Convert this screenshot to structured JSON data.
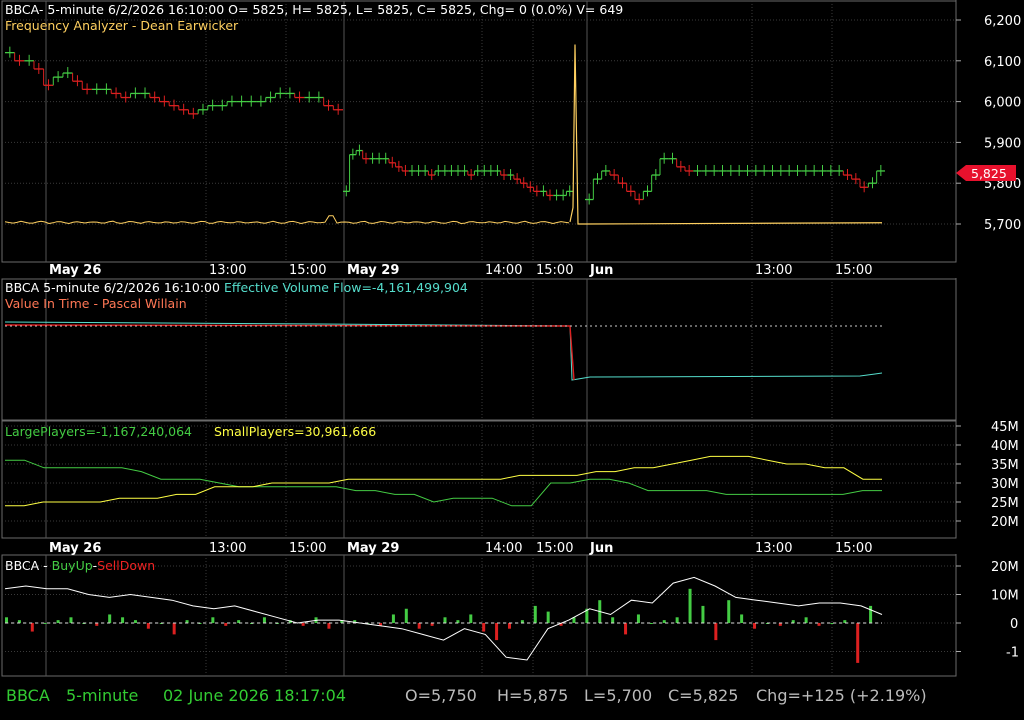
{
  "colors": {
    "background": "#000000",
    "grid": "#3a3a3a",
    "panel_border": "#6a6a6a",
    "bar_up": "#44cc44",
    "bar_down": "#dd2020",
    "frequency": "#ffd060",
    "white_line": "#ffffff",
    "evf": "#55ddcc",
    "large_players": "#44cc44",
    "small_players": "#ffff44",
    "status_green": "#33cc33",
    "status_gray": "#bbbbbb",
    "price_tag": "#e8112d"
  },
  "panel1": {
    "title": "BBCA- 5-minute 6/2/2026 16:10:00 O= 5825, H= 5825, L= 5825, C= 5825, Chg= 0 (0.0%) V= 649",
    "subtitle": "Frequency Analyzer - Dean Earwicker",
    "y_ticks": [
      "6,200",
      "6,100",
      "6,000",
      "5,900",
      "5,800",
      "5,700"
    ],
    "last_price": "5,825"
  },
  "time_axis": {
    "labels": [
      {
        "text": "May 26",
        "bold": true
      },
      {
        "text": "13:00",
        "bold": false
      },
      {
        "text": "15:00",
        "bold": false
      },
      {
        "text": "May 29",
        "bold": true
      },
      {
        "text": "14:00",
        "bold": false
      },
      {
        "text": "15:00",
        "bold": false
      },
      {
        "text": "Jun",
        "bold": true
      },
      {
        "text": "13:00",
        "bold": false
      },
      {
        "text": "15:00",
        "bold": false
      }
    ]
  },
  "panel2": {
    "title_prefix": "BBCA 5-minute  6/2/2026 16:10:00  ",
    "title_value": "Effective Volume Flow=-4,161,499,904",
    "subtitle": "Value In Time - Pascal Willain"
  },
  "panel3": {
    "large_label": "LargePlayers=-1,167,240,064",
    "small_label": "SmallPlayers=30,961,666",
    "y_ticks": [
      "45M",
      "40M",
      "35M",
      "30M",
      "25M",
      "20M"
    ]
  },
  "panel4": {
    "title_prefix": "BBCA - ",
    "title_up": "BuyUp",
    "title_sep": "-",
    "title_down": "SellDown",
    "y_ticks": [
      "20M",
      "10M",
      "0",
      "-1"
    ]
  },
  "status_bar": {
    "symbol": "BBCA",
    "interval": "5-minute",
    "datetime": "02 June 2026 18:17:04",
    "open": "O=5,750",
    "high": "H=5,875",
    "low": "L=5,700",
    "close": "C=5,825",
    "change": "Chg=+125 (+2.19%)"
  },
  "chart_data": {
    "type": "line",
    "price_panel": {
      "y_unit": "IDR",
      "ylim": [
        5670,
        6230
      ],
      "segments": [
        {
          "session": "May 26",
          "values": [
            6120,
            6100,
            6100,
            6080,
            6040,
            6060,
            6070,
            6050,
            6030,
            6030,
            6030,
            6020,
            6010,
            6020,
            6020,
            6010,
            6000,
            5990,
            5980,
            5970,
            5980,
            5990,
            5990,
            6000,
            6000,
            6000,
            6000,
            6010,
            6020,
            6020,
            6010,
            6010,
            6010,
            5990,
            5980
          ]
        },
        {
          "session": "May 29",
          "values": [
            5780,
            5870,
            5880,
            5860,
            5860,
            5860,
            5860,
            5850,
            5840,
            5830,
            5830,
            5830,
            5830,
            5820,
            5830,
            5830,
            5830,
            5830,
            5830,
            5820,
            5830,
            5830,
            5830,
            5830,
            5820,
            5820,
            5810,
            5800,
            5790,
            5780,
            5780,
            5770,
            5770,
            5770,
            5780
          ]
        },
        {
          "session": "Jun 2",
          "values": [
            5760,
            5810,
            5830,
            5820,
            5800,
            5780,
            5760,
            5780,
            5820,
            5860,
            5860,
            5840,
            5830,
            5830,
            5830,
            5830,
            5830,
            5830,
            5830,
            5830,
            5830,
            5830,
            5830,
            5830,
            5830,
            5830,
            5830,
            5830,
            5830,
            5830,
            5830,
            5820,
            5810,
            5790,
            5800,
            5830
          ]
        }
      ],
      "frequency_analyzer_note": "flat near 5,700 with one spike to ~6,140 at session change May 29 to Jun"
    },
    "evf_panel": {
      "series": [
        {
          "name": "Effective Volume Flow",
          "last": -4161499904
        }
      ]
    },
    "players_panel": {
      "y_unit": "M",
      "ylim": [
        17,
        47
      ],
      "series": [
        {
          "name": "LargePlayers",
          "values": [
            36,
            36,
            34,
            34,
            34,
            34,
            34,
            33,
            31,
            31,
            31,
            30,
            29,
            29,
            29,
            29,
            29,
            29,
            28,
            28,
            27,
            27,
            25,
            26,
            26,
            26,
            24,
            24,
            30,
            30,
            31,
            31,
            30,
            28,
            28,
            28,
            28,
            27,
            27,
            27,
            27,
            27,
            27,
            27,
            28,
            28
          ]
        },
        {
          "name": "SmallPlayers",
          "values": [
            24,
            24,
            25,
            25,
            25,
            25,
            26,
            26,
            26,
            27,
            27,
            29,
            29,
            29,
            30,
            30,
            30,
            30,
            31,
            31,
            31,
            31,
            31,
            31,
            31,
            31,
            31,
            32,
            32,
            32,
            32,
            33,
            33,
            34,
            34,
            35,
            36,
            37,
            37,
            37,
            36,
            35,
            35,
            34,
            34,
            31,
            31
          ]
        }
      ]
    },
    "buyup_selldown_panel": {
      "y_unit": "M",
      "ylim": [
        -18,
        25
      ],
      "bars": [
        2,
        1,
        -3,
        0,
        1,
        2,
        0,
        -1,
        3,
        2,
        1,
        -2,
        0,
        -4,
        1,
        0,
        2,
        -1,
        1,
        0,
        2,
        0,
        1,
        -1,
        2,
        -2,
        1,
        1,
        0,
        -1,
        3,
        5,
        -2,
        -1,
        2,
        1,
        3,
        -3,
        -6,
        -2,
        1,
        6,
        4,
        -1,
        2,
        5,
        8,
        2,
        -4,
        3,
        0,
        1,
        2,
        12,
        6,
        -6,
        8,
        3,
        -2,
        0,
        -1,
        1,
        2,
        -1,
        0,
        1,
        -14,
        6
      ],
      "white_line": [
        12,
        13,
        12,
        12,
        10,
        9,
        10,
        9,
        8,
        6,
        5,
        6,
        4,
        2,
        0,
        1,
        1,
        0,
        -1,
        -2,
        -4,
        -6,
        -2,
        -4,
        -12,
        -13,
        -2,
        1,
        5,
        3,
        8,
        7,
        14,
        16,
        13,
        9,
        8,
        7,
        6,
        7,
        7,
        6,
        3
      ]
    }
  }
}
